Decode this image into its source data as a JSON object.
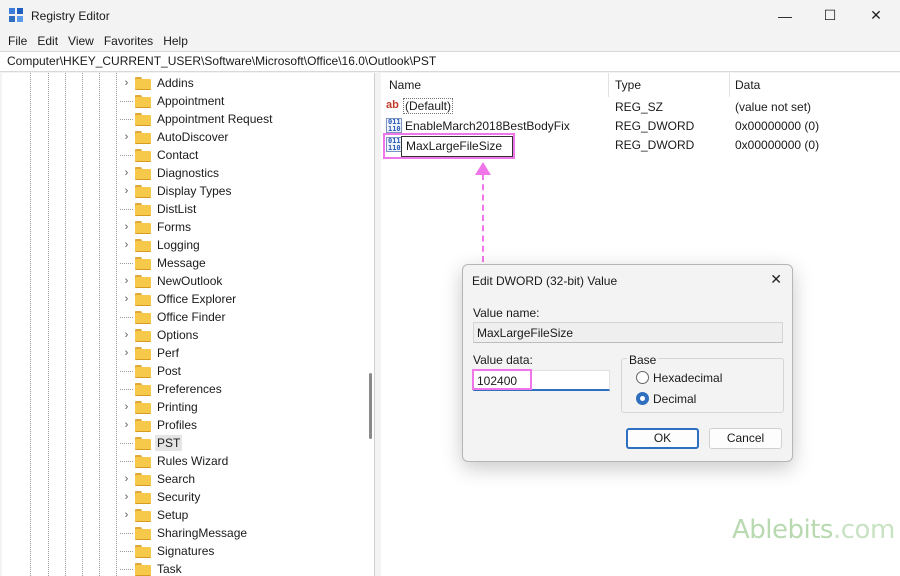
{
  "window": {
    "title": "Registry Editor",
    "minimize_glyph": "—",
    "maximize_glyph": "☐",
    "close_glyph": "✕"
  },
  "menu": [
    "File",
    "Edit",
    "View",
    "Favorites",
    "Help"
  ],
  "address": "Computer\\HKEY_CURRENT_USER\\Software\\Microsoft\\Office\\16.0\\Outlook\\PST",
  "tree": {
    "items": [
      {
        "label": "Addins",
        "expandable": true
      },
      {
        "label": "Appointment",
        "expandable": false
      },
      {
        "label": "Appointment Request",
        "expandable": false
      },
      {
        "label": "AutoDiscover",
        "expandable": true
      },
      {
        "label": "Contact",
        "expandable": false
      },
      {
        "label": "Diagnostics",
        "expandable": true
      },
      {
        "label": "Display Types",
        "expandable": true
      },
      {
        "label": "DistList",
        "expandable": false
      },
      {
        "label": "Forms",
        "expandable": true
      },
      {
        "label": "Logging",
        "expandable": true
      },
      {
        "label": "Message",
        "expandable": false
      },
      {
        "label": "NewOutlook",
        "expandable": true
      },
      {
        "label": "Office Explorer",
        "expandable": true
      },
      {
        "label": "Office Finder",
        "expandable": false
      },
      {
        "label": "Options",
        "expandable": true
      },
      {
        "label": "Perf",
        "expandable": true
      },
      {
        "label": "Post",
        "expandable": false
      },
      {
        "label": "Preferences",
        "expandable": false
      },
      {
        "label": "Printing",
        "expandable": true
      },
      {
        "label": "Profiles",
        "expandable": true
      },
      {
        "label": "PST",
        "expandable": false,
        "selected": true
      },
      {
        "label": "Rules Wizard",
        "expandable": false
      },
      {
        "label": "Search",
        "expandable": true
      },
      {
        "label": "Security",
        "expandable": true
      },
      {
        "label": "Setup",
        "expandable": true
      },
      {
        "label": "SharingMessage",
        "expandable": false
      },
      {
        "label": "Signatures",
        "expandable": false
      },
      {
        "label": "Task",
        "expandable": false
      }
    ]
  },
  "values": {
    "headers": {
      "name": "Name",
      "type": "Type",
      "data": "Data"
    },
    "rows": [
      {
        "icon": "string-value-icon",
        "icon_text": "ab",
        "name": "(Default)",
        "type": "REG_SZ",
        "data": "(value not set)"
      },
      {
        "icon": "dword-value-icon",
        "icon_text": "011\n110",
        "name": "EnableMarch2018BestBodyFix",
        "type": "REG_DWORD",
        "data": "0x00000000 (0)"
      },
      {
        "icon": "dword-value-icon",
        "icon_text": "011\n110",
        "name": "MaxLargeFileSize",
        "type": "REG_DWORD",
        "data": "0x00000000 (0)"
      }
    ]
  },
  "dialog": {
    "title": "Edit DWORD (32-bit) Value",
    "close_glyph": "✕",
    "value_name_label": "Value name:",
    "value_name": "MaxLargeFileSize",
    "value_data_label": "Value data:",
    "value_data": "102400",
    "base_label": "Base",
    "base_options": [
      {
        "label": "Hexadecimal",
        "selected": false
      },
      {
        "label": "Decimal",
        "selected": true
      }
    ],
    "ok_label": "OK",
    "cancel_label": "Cancel"
  },
  "watermark": {
    "brand": "Ablebits",
    "suffix": ".com"
  },
  "colors": {
    "highlight": "#f075e8",
    "accent": "#2f6fbf",
    "folder": "#f6c94a"
  }
}
